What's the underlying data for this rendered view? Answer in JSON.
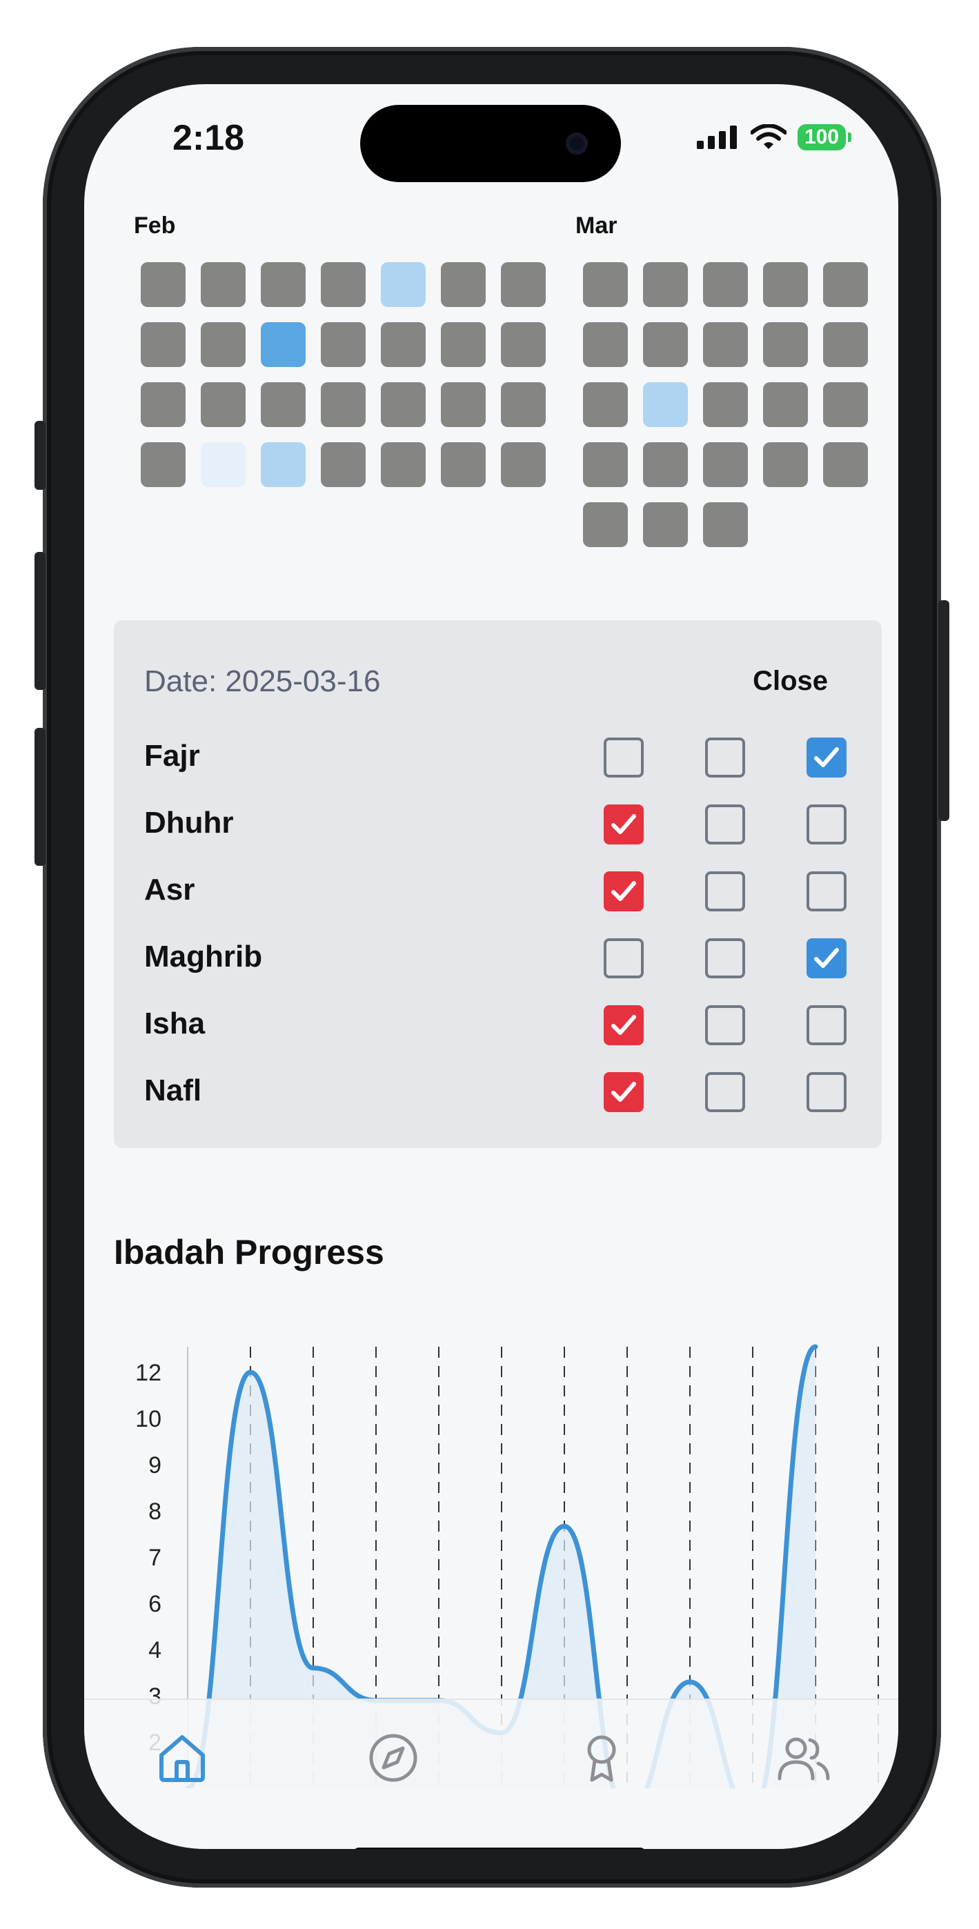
{
  "status_bar": {
    "time": "2:18",
    "battery": "100"
  },
  "calendar": {
    "feb": {
      "label": "Feb",
      "levels": [
        0,
        0,
        0,
        0,
        2,
        0,
        0,
        0,
        0,
        3,
        0,
        0,
        0,
        0,
        0,
        0,
        0,
        0,
        0,
        0,
        0,
        0,
        1,
        2,
        0,
        0,
        0,
        0
      ]
    },
    "mar": {
      "label": "Mar",
      "levels": [
        0,
        0,
        0,
        0,
        0,
        0,
        0,
        0,
        0,
        0,
        0,
        2,
        0,
        0,
        0,
        0,
        0,
        0,
        0,
        0,
        0,
        0,
        0
      ]
    }
  },
  "day_panel": {
    "date": "Date: 2025-03-16",
    "close_label": "Close",
    "prayers": [
      {
        "name": "Fajr",
        "checks": [
          "",
          "",
          "blue"
        ]
      },
      {
        "name": "Dhuhr",
        "checks": [
          "red",
          "",
          ""
        ]
      },
      {
        "name": "Asr",
        "checks": [
          "red",
          "",
          ""
        ]
      },
      {
        "name": "Maghrib",
        "checks": [
          "",
          "",
          "blue"
        ]
      },
      {
        "name": "Isha",
        "checks": [
          "red",
          "",
          ""
        ]
      },
      {
        "name": "Nafl",
        "checks": [
          "red",
          "",
          ""
        ]
      }
    ]
  },
  "progress": {
    "title": "Ibadah Progress",
    "chart_data": {
      "type": "area",
      "y_tick_labels": [
        "12",
        "10",
        "9",
        "8",
        "7",
        "6",
        "4",
        "3",
        "2"
      ],
      "ylim": [
        2,
        12
      ],
      "grid": "vertical dashed lines",
      "series": [
        {
          "values": [
            1,
            12,
            3.6,
            2.9,
            2.9,
            2.2,
            8,
            0.5,
            3.3,
            0.5,
            13
          ]
        }
      ],
      "colors": {
        "line": "#3d92d6",
        "fill": "#dbe9f6",
        "grid": "#333333"
      }
    }
  },
  "tab_bar": {
    "tabs": [
      {
        "icon": "home-icon",
        "active": true
      },
      {
        "icon": "compass-icon",
        "active": false
      },
      {
        "icon": "award-icon",
        "active": false
      },
      {
        "icon": "users-icon",
        "active": false
      }
    ],
    "colors": {
      "active": "#3d92d6",
      "inactive": "#8e8e93"
    }
  }
}
